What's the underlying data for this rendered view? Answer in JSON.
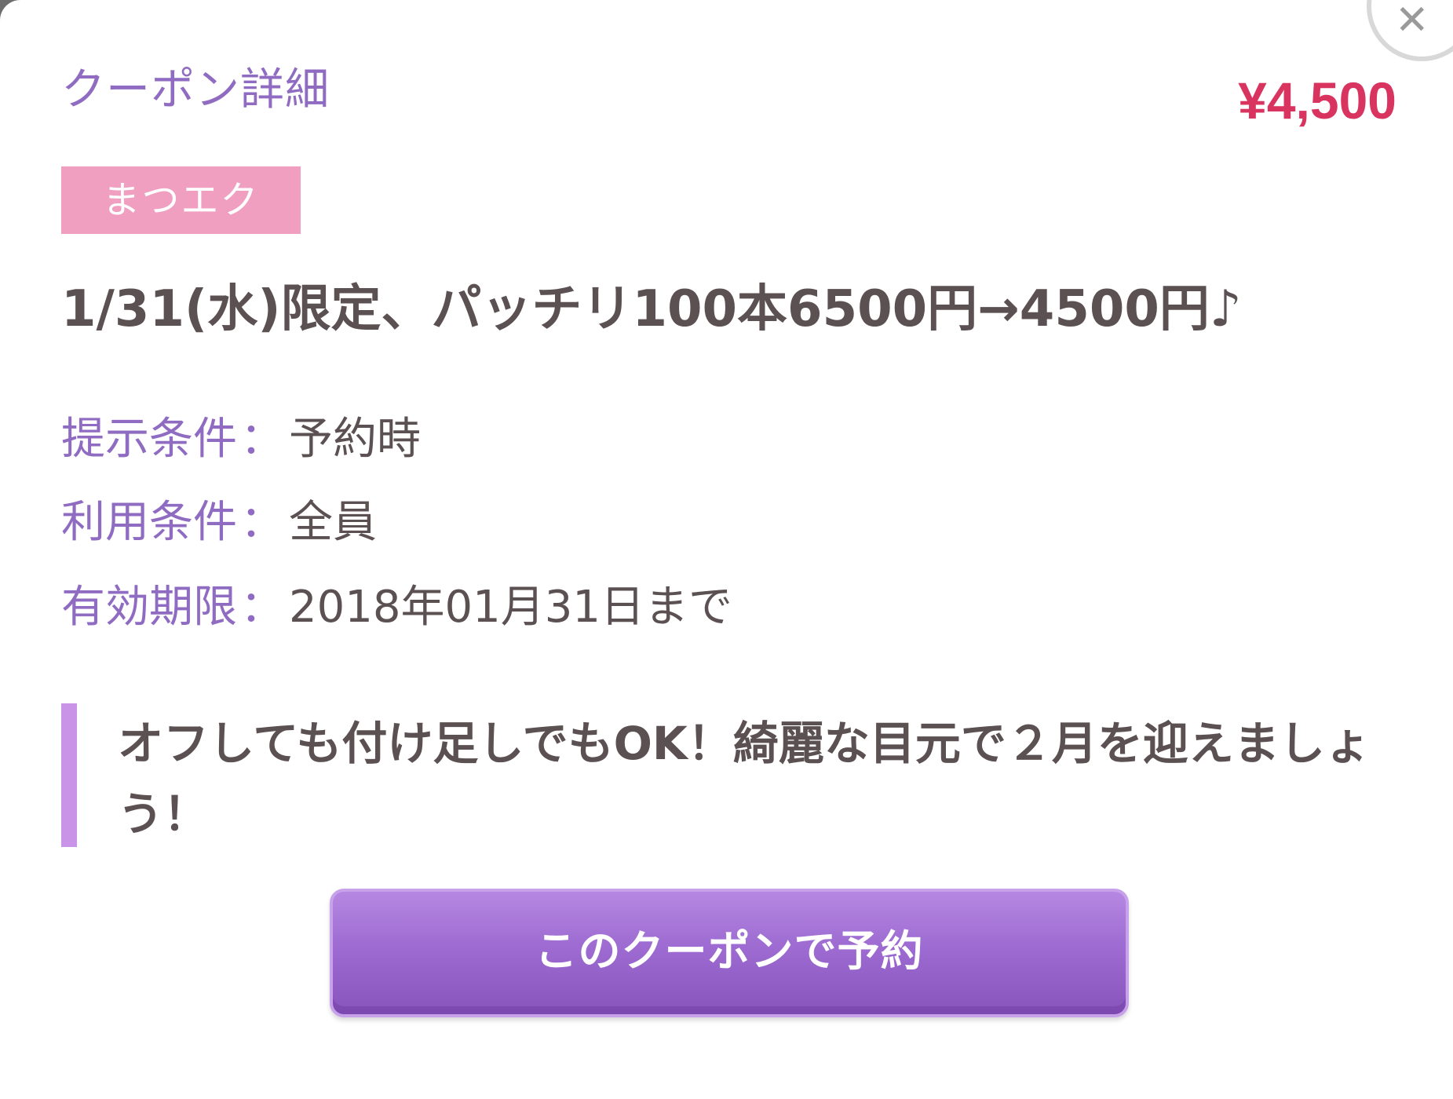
{
  "modal": {
    "header_title": "クーポン詳細",
    "price": "¥4,500",
    "close_icon_glyph": "✕"
  },
  "coupon": {
    "category": "まつエク",
    "title": "1/31(水)限定、パッチリ100本6500円→4500円♪",
    "conditions": [
      {
        "label": "提示条件",
        "value": "予約時"
      },
      {
        "label": "利用条件",
        "value": "全員"
      },
      {
        "label": "有効期限",
        "value": "2018年01月31日まで"
      }
    ],
    "separator": "：",
    "message": "オフしても付け足しでもOK！綺麗な目元で２月を迎えましょう！"
  },
  "actions": {
    "reserve_label": "このクーポンで予約"
  },
  "colors": {
    "accent_purple": "#8f6cc2",
    "price_red": "#d8345f",
    "badge_pink": "#f09fc0",
    "quote_bar": "#c994e8",
    "text_dark": "#5c5152",
    "button_purple": "#9d6bd1"
  }
}
